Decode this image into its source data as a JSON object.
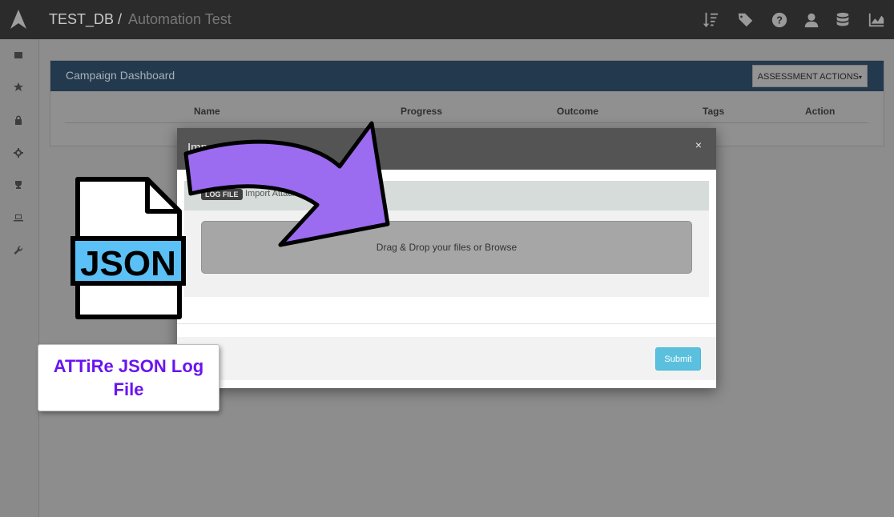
{
  "header": {
    "db_name": "TEST_DB /",
    "page_name": "Automation Test",
    "icons": [
      "sort-filter-icon",
      "tags-icon",
      "help-icon",
      "user-icon",
      "database-icon",
      "area-chart-icon"
    ]
  },
  "sidebar": {
    "icons": [
      "dashboard-icon",
      "star-icon",
      "lock-icon",
      "crosshair-icon",
      "trophy-icon",
      "laptop-icon",
      "wrench-icon"
    ]
  },
  "panel": {
    "title": "Campaign Dashboard",
    "actions_label": "ASSESSMENT ACTIONS",
    "columns": [
      "Name",
      "Progress",
      "Outcome",
      "Tags",
      "Action"
    ]
  },
  "modal": {
    "title": "Imp",
    "close": "×",
    "log_badge": "LOG FILE",
    "log_text": "Import Attack",
    "dropzone_text": "Drag & Drop your files or Browse",
    "submit_label": "Submit"
  },
  "annotation": {
    "json_label": "JSON",
    "callout_text": "ATTiRe JSON Log File",
    "colors": {
      "arrow": "#9b6cf0",
      "json_band": "#5bc0f5",
      "callout_text": "#6a14f0"
    }
  }
}
